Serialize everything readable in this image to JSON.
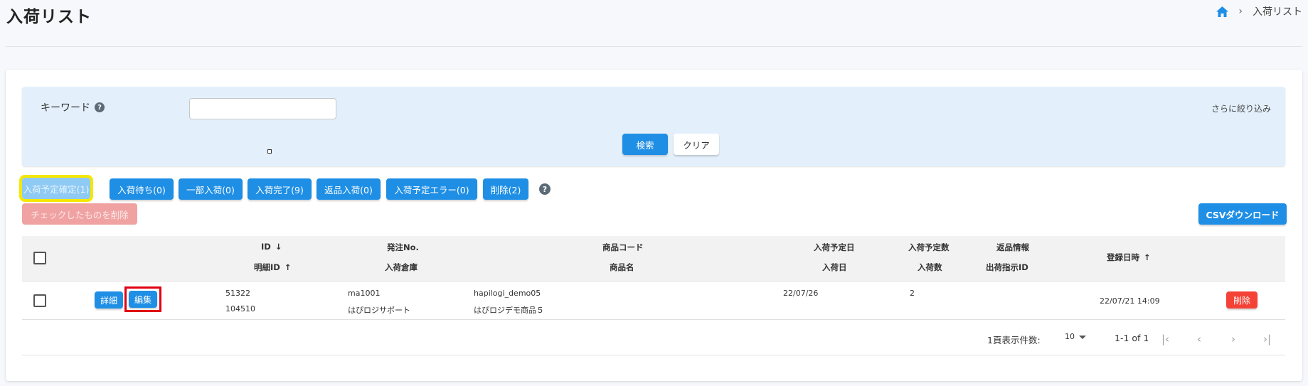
{
  "header": {
    "title": "入荷リスト",
    "breadcrumb_current": "入荷リスト"
  },
  "search": {
    "keyword_label": "キーワード",
    "keyword_value": "",
    "keyword_placeholder": "",
    "narrow_link": "さらに絞り込み",
    "search_button": "検索",
    "clear_button": "クリア"
  },
  "tabs": [
    {
      "label": "入荷予定確定(1)",
      "active": true
    },
    {
      "label": "入荷待ち(0)"
    },
    {
      "label": "一部入荷(0)"
    },
    {
      "label": "入荷完了(9)"
    },
    {
      "label": "返品入荷(0)"
    },
    {
      "label": "入荷予定エラー(0)"
    },
    {
      "label": "削除(2)"
    }
  ],
  "actions": {
    "delete_checked": "チェックしたものを削除",
    "csv_download": "CSVダウンロード"
  },
  "table": {
    "headers": {
      "id": "ID",
      "detail_id": "明細ID",
      "order_no": "発注No.",
      "warehouse": "入荷倉庫",
      "product_code": "商品コード",
      "product_name": "商品名",
      "scheduled_date": "入荷予定日",
      "arrival_date": "入荷日",
      "scheduled_qty": "入荷予定数",
      "arrival_qty": "入荷数",
      "return_info": "返品情報",
      "shipping_id": "出荷指示ID",
      "registered_at": "登録日時"
    },
    "rows": [
      {
        "detail_button": "詳細",
        "edit_button": "編集",
        "id": "51322",
        "detail_id": "104510",
        "order_no": "ma1001",
        "warehouse": "はぴロジサポート",
        "product_code": "hapilogi_demo05",
        "product_name": "はぴロジデモ商品５",
        "scheduled_date": "22/07/26",
        "arrival_date": "",
        "scheduled_qty": "2",
        "arrival_qty": "",
        "return_info": "",
        "shipping_id": "",
        "registered_at": "22/07/21 14:09",
        "delete_button": "削除"
      }
    ]
  },
  "pagination": {
    "per_page_label": "1頁表示件数:",
    "per_page_value": "10",
    "range": "1-1 of 1"
  },
  "colors": {
    "primary": "#1f8fe5",
    "danger": "#f44336",
    "highlight_yellow": "#f5e800",
    "highlight_red": "#e00012"
  }
}
